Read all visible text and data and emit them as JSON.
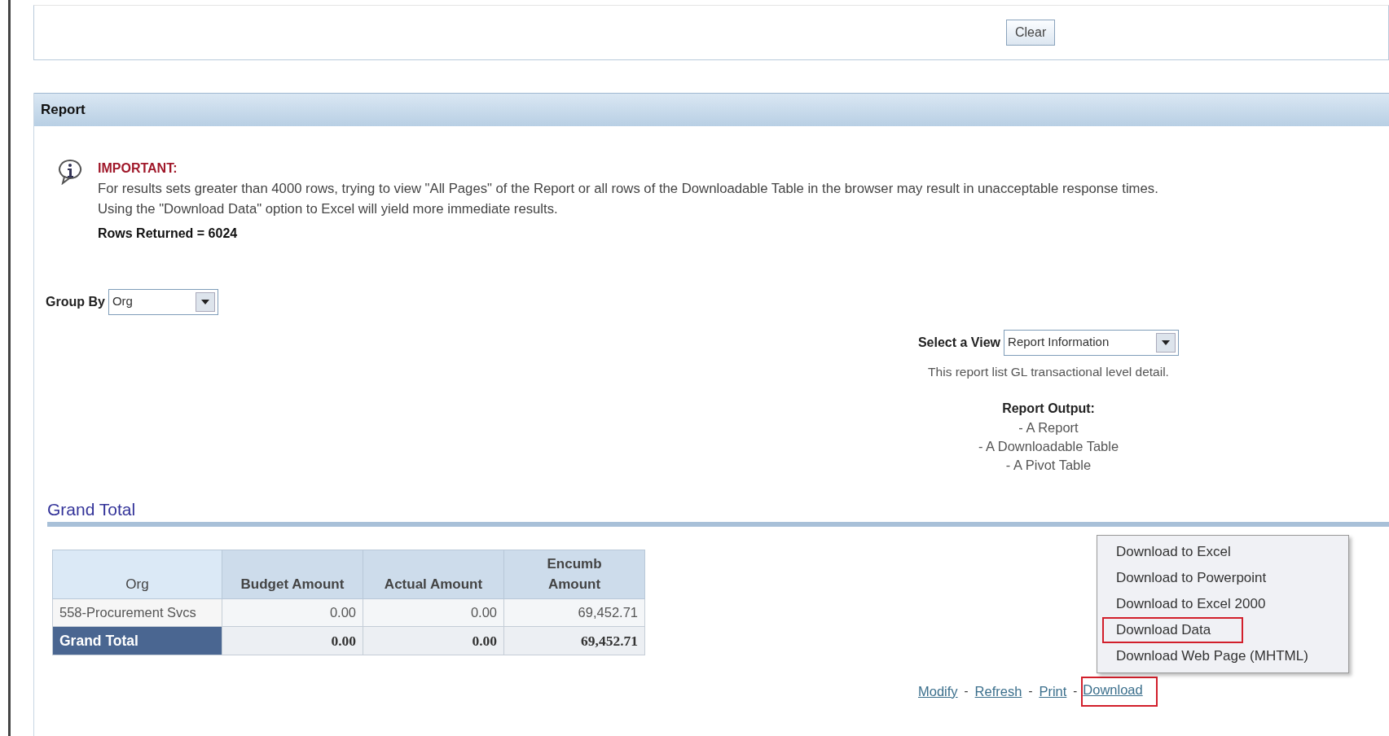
{
  "search_panel": {
    "clear_button": "Clear"
  },
  "report": {
    "title": "Report",
    "notice": {
      "heading": "IMPORTANT:",
      "lines": [
        "For results sets greater than 4000 rows, trying to view \"All Pages\" of the Report or all rows of the Downloadable Table in the browser may result in unacceptable response times.",
        "Using the \"Download Data\" option to Excel will yield more immediate results."
      ],
      "rows_returned": "Rows Returned = 6024"
    },
    "group_by": {
      "label": "Group By",
      "value": "Org"
    },
    "view": {
      "label": "Select a View",
      "value": "Report Information",
      "description": "This report list GL transactional level detail.",
      "output_heading": "Report Output:",
      "outputs": [
        "- A Report",
        "- A Downloadable Table",
        "- A Pivot Table"
      ]
    },
    "section_title": "Grand Total",
    "table": {
      "columns": [
        "Org",
        "Budget Amount",
        "Actual Amount",
        "Encumb Amount"
      ],
      "rows": [
        {
          "kind": "data",
          "cells": [
            "558-Procurement Svcs",
            "0.00",
            "0.00",
            "69,452.71"
          ]
        },
        {
          "kind": "total",
          "cells": [
            "Grand Total",
            "0.00",
            "0.00",
            "69,452.71"
          ]
        }
      ]
    },
    "links": [
      {
        "label": "Modify",
        "highlighted": false
      },
      {
        "separator": "-",
        "label": "Refresh",
        "highlighted": false
      },
      {
        "separator": "-",
        "label": "Print",
        "highlighted": false
      },
      {
        "separator": "-",
        "label": "Download",
        "highlighted": true
      }
    ],
    "download_menu": [
      {
        "label": "Download to Excel",
        "highlighted": false
      },
      {
        "label": "Download to Powerpoint",
        "highlighted": false
      },
      {
        "label": "Download to Excel 2000",
        "highlighted": false
      },
      {
        "label": "Download Data",
        "highlighted": true
      },
      {
        "label": "Download Web Page (MHTML)",
        "highlighted": false
      }
    ]
  }
}
